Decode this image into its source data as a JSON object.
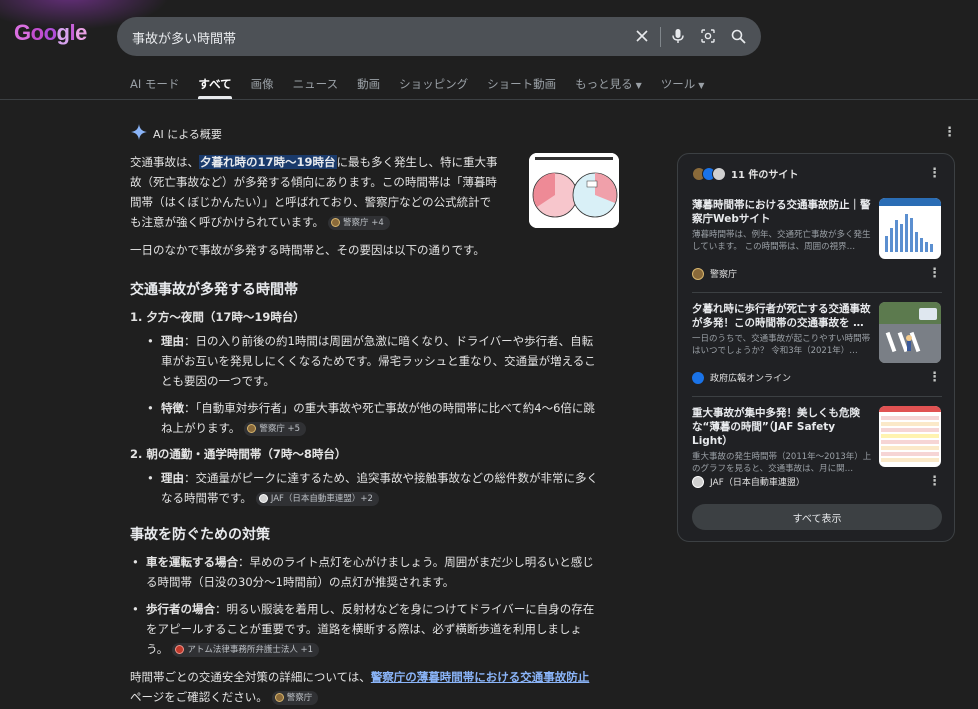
{
  "logo": {
    "letters": [
      "G",
      "o",
      "o",
      "g",
      "l",
      "e"
    ],
    "colors": [
      "#d96ee0",
      "#c24fd0",
      "#b04dd8",
      "#d7a2ee",
      "#c760d8",
      "#e9a0e5"
    ]
  },
  "search": {
    "query": "事故が多い時間帯"
  },
  "tabs": [
    {
      "label": "AI モード"
    },
    {
      "label": "すべて",
      "active": true
    },
    {
      "label": "画像"
    },
    {
      "label": "ニュース"
    },
    {
      "label": "動画"
    },
    {
      "label": "ショッピング"
    },
    {
      "label": "ショート動画"
    },
    {
      "label": "もっと見る"
    },
    {
      "label": "ツール"
    }
  ],
  "ai": {
    "heading": "AI による概要",
    "intro_pre": "交通事故は、",
    "intro_hl": "夕暮れ時の17時〜19時台",
    "intro_l1_post": "に最も多く発生し、特に重大事",
    "intro_l2": "故（死亡事故など）が多発する傾向にあります。この時間帯は「薄暮時",
    "intro_l3": "間帯（はくぼじかんたい）」と呼ばれており、警察庁などの公式統計で",
    "intro_l4": "も注意が強く呼びかけられています。",
    "intro_src": "警察庁 +4",
    "para2": "一日のなかで事故が多発する時間帯と、その要因は以下の通りです。",
    "sec1_title": "交通事故が多発する時間帯",
    "item1_title": "1. 夕方〜夜間（17時〜19時台）",
    "item1_b1_label": "理由",
    "item1_b1_l1": "：日の入り前後の約1時間は周囲が急激に暗くなり、ドライバーや歩行者、自転",
    "item1_b1_l2": "車がお互いを発見しにくくなるためです。帰宅ラッシュと重なり、交通量が増えるこ",
    "item1_b1_l3": "とも要因の一つです。",
    "item1_b2_label": "特徴",
    "item1_b2_l1": "：「自動車対歩行者」の重大事故や死亡事故が他の時間帯に比べて約4〜6倍に跳",
    "item1_b2_l2": "ね上がります。",
    "item1_b2_src": "警察庁 +5",
    "item2_title": "2. 朝の通勤・通学時間帯（7時〜8時台）",
    "item2_b1_label": "理由",
    "item2_b1_l1": "：交通量がピークに達するため、追突事故や接触事故などの総件数が非常に多く",
    "item2_b1_l2": "なる時間帯です。",
    "item2_b1_src": "JAF（日本自動車連盟）+2",
    "sec2_title": "事故を防ぐための対策",
    "s2_b1_label": "車を運転する場合",
    "s2_b1_l1": "：早めのライト点灯を心がけましょう。周囲がまだ少し明るいと感じ",
    "s2_b1_l2": "る時間帯（日没の30分〜1時間前）の点灯が推奨されます。",
    "s2_b2_label": "歩行者の場合",
    "s2_b2_l1": "：明るい服装を着用し、反射材などを身につけてドライバーに自身の存在",
    "s2_b2_l2": "をアピールすることが重要です。道路を横断する際は、必ず横断歩道を利用しましょ",
    "s2_b2_l3": "う。",
    "s2_b2_src": "アトム法律事務所弁護士法人 +1",
    "closing_pre": "時間帯ごとの交通安全対策の詳細については、",
    "closing_link": "警察庁の薄暮時間帯における交通事故防止",
    "closing_post": "ページをご確認ください。",
    "closing_src": "警察庁"
  },
  "panel": {
    "count_label": "11 件のサイト",
    "cards": [
      {
        "title": "薄暮時間帯における交通事故防止｜警察庁Webサイト",
        "snippet": "薄暮時間帯は、例年、交通死亡事故が多く発生しています。 この時間帯は、周囲の視界…",
        "source": "警察庁"
      },
      {
        "title": "夕暮れ時に歩行者が死亡する交通事故が多発！この時間帯の交通事故を …",
        "snippet": "一日のうちで、交通事故が起こりやすい時間帯はいつでしょうか？ 令和3年（2021年）…",
        "source": "政府広報オンライン"
      },
      {
        "title": "重大事故が集中多発！美しくも危険な“薄暮の時間”（JAF Safety Light）",
        "snippet": "重大事故の発生時間帯（2011年〜2013年）上のグラフを見ると、交通事故は、月に関…",
        "source": "JAF（日本自動車連盟）"
      }
    ],
    "show_all": "すべて表示"
  }
}
